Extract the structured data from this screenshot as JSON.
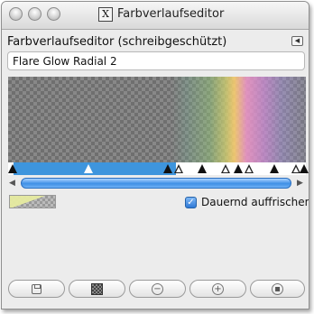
{
  "window": {
    "title": "Farbverlaufseditor",
    "app_icon_glyph": "X"
  },
  "editor": {
    "header_label": "Farbverlaufseditor (schreibgeschützt)",
    "menu_icon": "menu-triangle-icon",
    "gradient_name": "Flare Glow Radial 2"
  },
  "colors": {
    "selection": "#3e95dd",
    "scroll_thumb": "#3f8fe6",
    "checkbox": "#2f79d6"
  },
  "stops": [
    {
      "kind": "black"
    },
    {
      "kind": "white"
    },
    {
      "kind": "black"
    },
    {
      "kind": "white"
    },
    {
      "kind": "black"
    },
    {
      "kind": "white"
    },
    {
      "kind": "black"
    },
    {
      "kind": "white"
    },
    {
      "kind": "black"
    },
    {
      "kind": "white"
    },
    {
      "kind": "black"
    }
  ],
  "options": {
    "instant_update_label": "Dauernd auffrischen",
    "instant_update_checked": true
  },
  "buttons": {
    "save_icon": "save-icon",
    "edit_icon": "edit-gradient-icon",
    "zoom_out_icon": "zoom-out-icon",
    "zoom_in_icon": "zoom-in-icon",
    "zoom_fit_icon": "zoom-all-icon"
  }
}
